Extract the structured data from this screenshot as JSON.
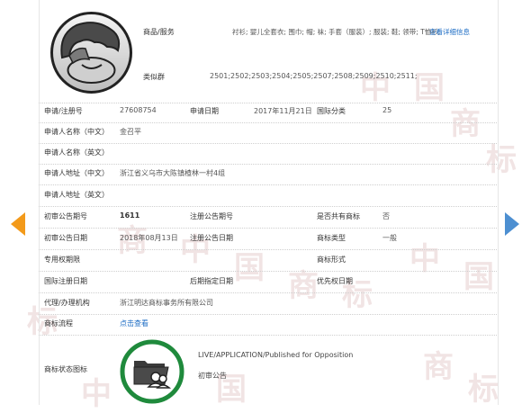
{
  "header": {
    "goods_label": "商品/服务",
    "goods_value": "衬衫; 婴儿全套衣; 围巾; 帽; 袜; 手套（服装）; 服装; 鞋; 领带; T恤衫;",
    "goods_link": "查看详细信息",
    "similar_label": "类似群",
    "similar_value": "2501;2502;2503;2504;2505;2507;2508;2509;2510;2511;"
  },
  "fields": {
    "reg_no_label": "申请/注册号",
    "reg_no_value": "27608754",
    "app_date_label": "申请日期",
    "app_date_value": "2017年11月21日",
    "intl_class_label": "国际分类",
    "intl_class_value": "25",
    "applicant_cn_label": "申请人名称（中文）",
    "applicant_cn_value": "金召平",
    "applicant_en_label": "申请人名称（英文）",
    "addr_cn_label": "申请人地址（中文）",
    "addr_cn_value": "浙江省义乌市大陈镇楂林一村4组",
    "addr_en_label": "申请人地址（英文）",
    "prelim_no_label": "初审公告期号",
    "prelim_no_value": "1611",
    "reg_pub_no_label": "注册公告期号",
    "shared_label": "是否共有商标",
    "shared_value": "否",
    "prelim_date_label": "初审公告日期",
    "prelim_date_value": "2018年08月13日",
    "reg_pub_date_label": "注册公告日期",
    "tm_type_label": "商标类型",
    "tm_type_value": "一般",
    "exclusive_label": "专用权期限",
    "tm_form_label": "商标形式",
    "intl_reg_date_label": "国际注册日期",
    "later_date_label": "后期指定日期",
    "priority_date_label": "优先权日期",
    "agent_label": "代理/办理机构",
    "agent_value": "浙江明达商标事务所有限公司",
    "flow_label": "商标流程",
    "flow_link": "点击查看",
    "status_label": "商标状态图标",
    "status_en": "LIVE/APPLICATION/Published for Opposition",
    "status_cn": "初审公告"
  },
  "watermark": [
    "中",
    "国",
    "商",
    "标",
    "中",
    "国",
    "商",
    "标",
    "中",
    "国",
    "商",
    "标",
    "中",
    "国",
    "商",
    "标"
  ],
  "colors": {
    "link": "#1c6cc4",
    "left_arrow": "#f39a1a",
    "right_arrow": "#4d8fd1",
    "status_ring": "#1f8a3c"
  },
  "icons": {
    "avatar": "facepalm-icon",
    "status": "folder-users-icon"
  }
}
